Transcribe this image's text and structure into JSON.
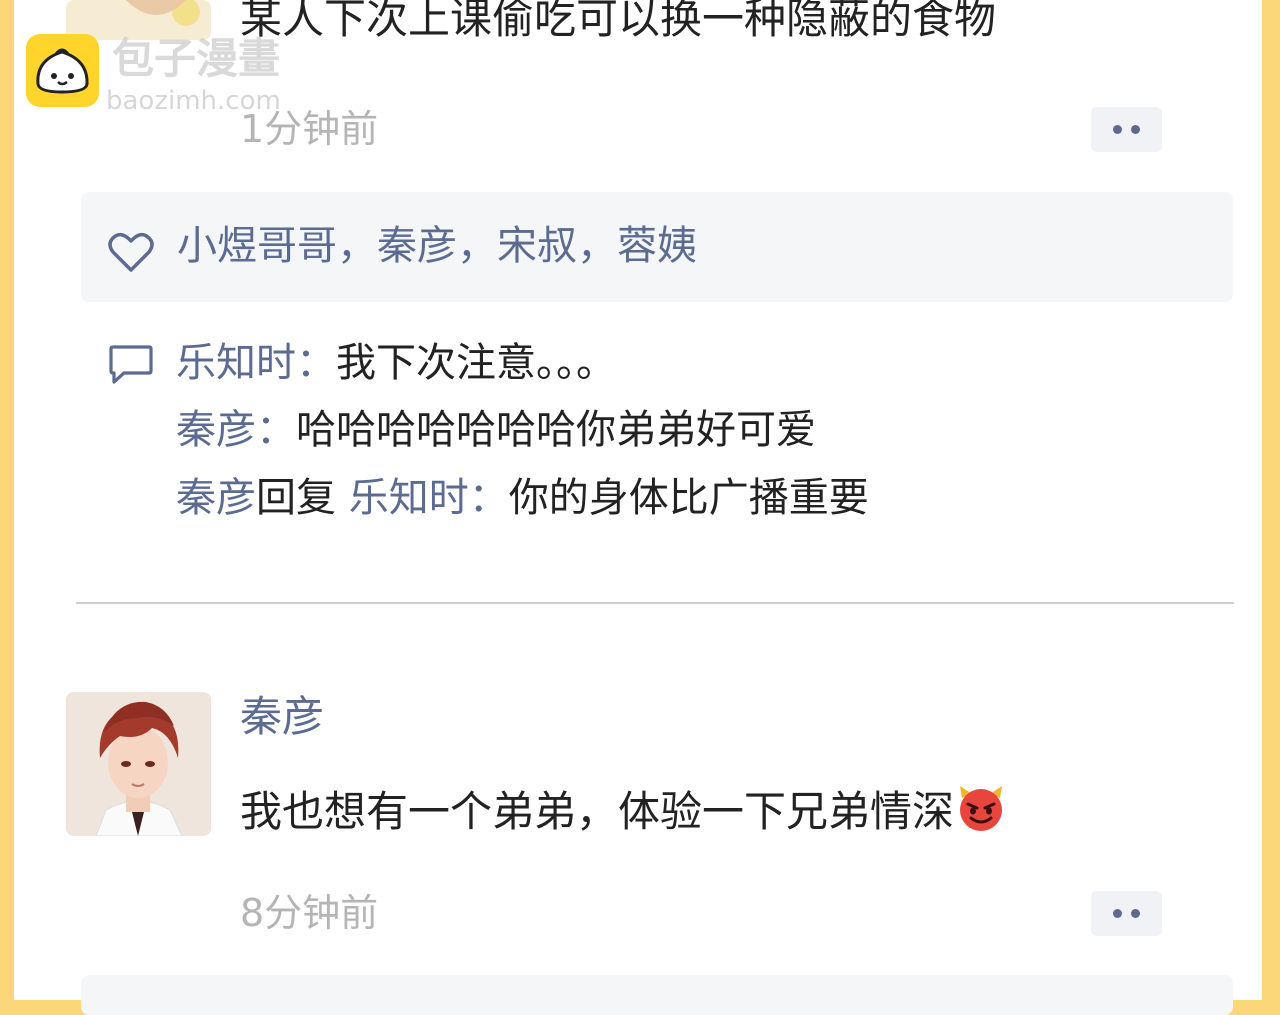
{
  "watermark": {
    "name_cn": "包子漫畫",
    "domain": "baozimh.com"
  },
  "post1": {
    "text": "某人下次上课偷吃可以换一种隐蔽的食物",
    "time": "1分钟前",
    "more_icon": "more-dots-icon",
    "likes": "小煜哥哥，秦彦，宋叔，蓉姨",
    "comments": [
      {
        "name": "乐知时",
        "sep": "：",
        "text": "我下次注意。。。"
      },
      {
        "name": "秦彦",
        "sep": "：",
        "text": "哈哈哈哈哈哈哈你弟弟好可爱"
      },
      {
        "name": "秦彦",
        "reply_word": "回复",
        "target": "乐知时",
        "sep": "：",
        "text": "你的身体比广播重要"
      }
    ]
  },
  "post2": {
    "author": "秦彦",
    "text": "我也想有一个弟弟，体验一下兄弟情深",
    "emoji": "devil-emoji-icon",
    "time": "8分钟前",
    "more_icon": "more-dots-icon"
  },
  "colors": {
    "name_blue": "#5b6b92",
    "border_yellow": "#fcd77a",
    "time_gray": "#b5b5b5"
  }
}
